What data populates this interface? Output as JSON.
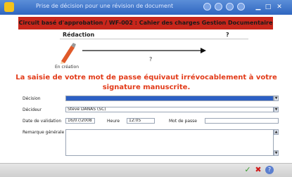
{
  "window": {
    "title": "Prise de décision pour une révision de document"
  },
  "banner": {
    "text": "Circuit basé d'approbation / WF-002 : Cahier des charges Gestion Documentaire"
  },
  "workflow": {
    "current_step": "Rédaction",
    "next_step": "?",
    "arrow_label": "?",
    "status_label": "En création"
  },
  "warning": {
    "line1": "La saisie de votre mot de passe équivaut irrévocablement à votre",
    "line2": "signature manuscrite."
  },
  "form": {
    "decision_label": "Décision",
    "decision_value": "",
    "decideur_label": "Décideur",
    "decideur_value": "Steve DANAS (SC)",
    "date_label": "Date de validation",
    "date_value": "16/07/2008",
    "heure_label": "Heure",
    "heure_value": "12:05",
    "password_label": "Mot de passe",
    "remarks_label": "Remarque générale"
  },
  "icons": {
    "app": "app-icon",
    "pen": "pen-icon",
    "ok": "check-icon",
    "stop": "stop-icon",
    "help": "help-icon"
  },
  "colors": {
    "titlebar": "#3a72cc",
    "banner": "#c8261b",
    "warning": "#e23a18",
    "selection": "#2c5fc4"
  }
}
